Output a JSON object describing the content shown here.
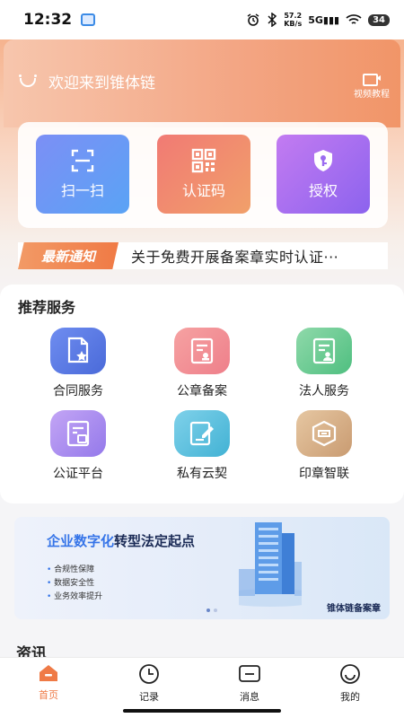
{
  "status_bar": {
    "time": "12:32",
    "speed_value": "57.2",
    "speed_unit": "KB/s",
    "network": "5G",
    "battery": "34"
  },
  "header": {
    "welcome": "欢迎来到锥体链",
    "video_tutorial": "视频教程"
  },
  "quick_actions": [
    {
      "label": "扫一扫",
      "icon": "scan-icon"
    },
    {
      "label": "认证码",
      "icon": "qr-code-icon"
    },
    {
      "label": "授权",
      "icon": "key-shield-icon"
    }
  ],
  "notice": {
    "tag": "最新通知",
    "text": "关于免费开展备案章实时认证···"
  },
  "services": {
    "title": "推荐服务",
    "items": [
      {
        "label": "合同服务",
        "icon": "contract-star-icon"
      },
      {
        "label": "公章备案",
        "icon": "seal-record-icon"
      },
      {
        "label": "法人服务",
        "icon": "legal-person-icon"
      },
      {
        "label": "公证平台",
        "icon": "notary-icon"
      },
      {
        "label": "私有云契",
        "icon": "private-cloud-sign-icon"
      },
      {
        "label": "印章智联",
        "icon": "stamp-link-icon"
      }
    ]
  },
  "banner": {
    "headline_highlight": "企业数字化",
    "headline_rest": "转型法定起点",
    "bullets": [
      "合规性保障",
      "数据安全性",
      "业务效率提升"
    ],
    "brand": "锥体链备案章"
  },
  "news_section_title": "资讯",
  "tabbar": [
    {
      "label": "首页",
      "icon": "home-icon"
    },
    {
      "label": "记录",
      "icon": "clock-icon"
    },
    {
      "label": "消息",
      "icon": "message-icon"
    },
    {
      "label": "我的",
      "icon": "profile-icon"
    }
  ],
  "colors": {
    "accent": "#ef7a46",
    "hero_gradient_start": "#f6b38e",
    "banner_highlight": "#3574e8"
  }
}
